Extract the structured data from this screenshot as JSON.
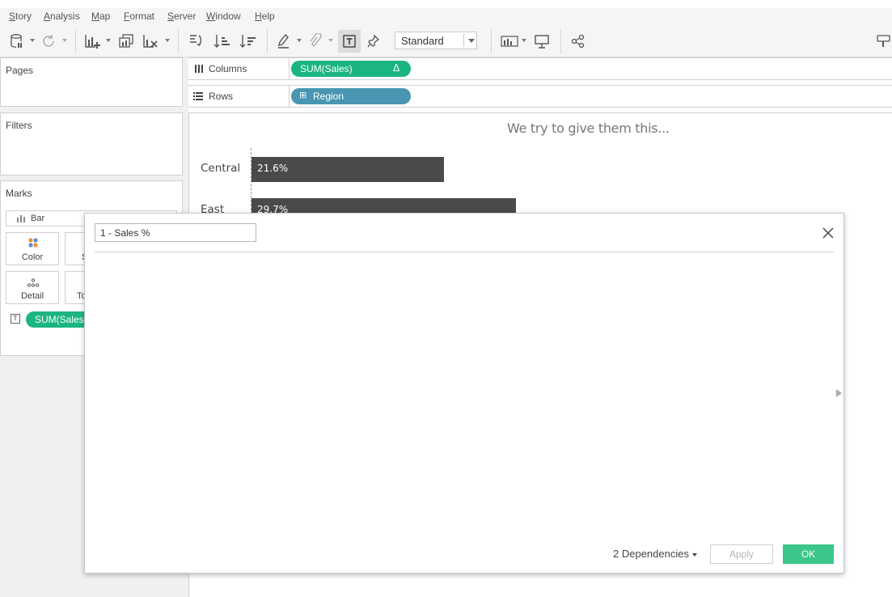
{
  "menu": [
    "Story",
    "Analysis",
    "Map",
    "Format",
    "Server",
    "Window",
    "Help"
  ],
  "toolbar": {
    "fit_dropdown": "Standard"
  },
  "panels": {
    "pages": "Pages",
    "filters": "Filters",
    "marks": "Marks"
  },
  "marks": {
    "type": "Bar",
    "buttons": [
      "Color",
      "S",
      "Detail",
      "To"
    ],
    "pill": "SUM(Sales"
  },
  "shelves": {
    "columns_label": "Columns",
    "columns_pill": "SUM(Sales)",
    "columns_delta": "Δ",
    "rows_label": "Rows",
    "rows_pill": "Region",
    "rows_pill_icon": "⊞"
  },
  "view": {
    "title": "We try to give them this...",
    "chart_data": {
      "type": "bar",
      "orientation": "horizontal",
      "title": "We try to give them this...",
      "categories": [
        "Central",
        "East"
      ],
      "values": [
        21.6,
        29.7
      ],
      "value_labels": [
        "21.6%",
        "29.7%"
      ],
      "unit": "%",
      "xlim": [
        0,
        60
      ]
    }
  },
  "dialog": {
    "name_value": "1 - Sales %",
    "dependencies": "2 Dependencies",
    "apply": "Apply",
    "ok": "OK"
  },
  "colors": {
    "measure_pill": "#1bb57f",
    "dimension_pill": "#4996b2",
    "bar": "#4a4a4a",
    "ok_button": "#3cc68a"
  }
}
